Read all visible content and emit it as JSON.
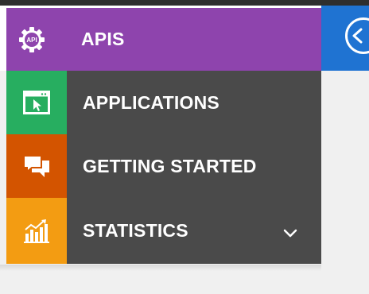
{
  "menu": {
    "items": [
      {
        "label": "APIS",
        "icon": "api-gear-icon",
        "active": true,
        "color": "#8e44ad"
      },
      {
        "label": "APPLICATIONS",
        "icon": "application-window-icon",
        "color": "#27ae60"
      },
      {
        "label": "GETTING STARTED",
        "icon": "chat-bubbles-icon",
        "color": "#d35400"
      },
      {
        "label": "STATISTICS",
        "icon": "bar-chart-icon",
        "color": "#f39c12",
        "expandable": true
      }
    ]
  },
  "header": {
    "back_icon": "back-arrow-circle-icon",
    "color": "#1f73d2"
  },
  "colors": {
    "menu_background": "#4a4a4a",
    "page_background": "#f0f0f0"
  }
}
